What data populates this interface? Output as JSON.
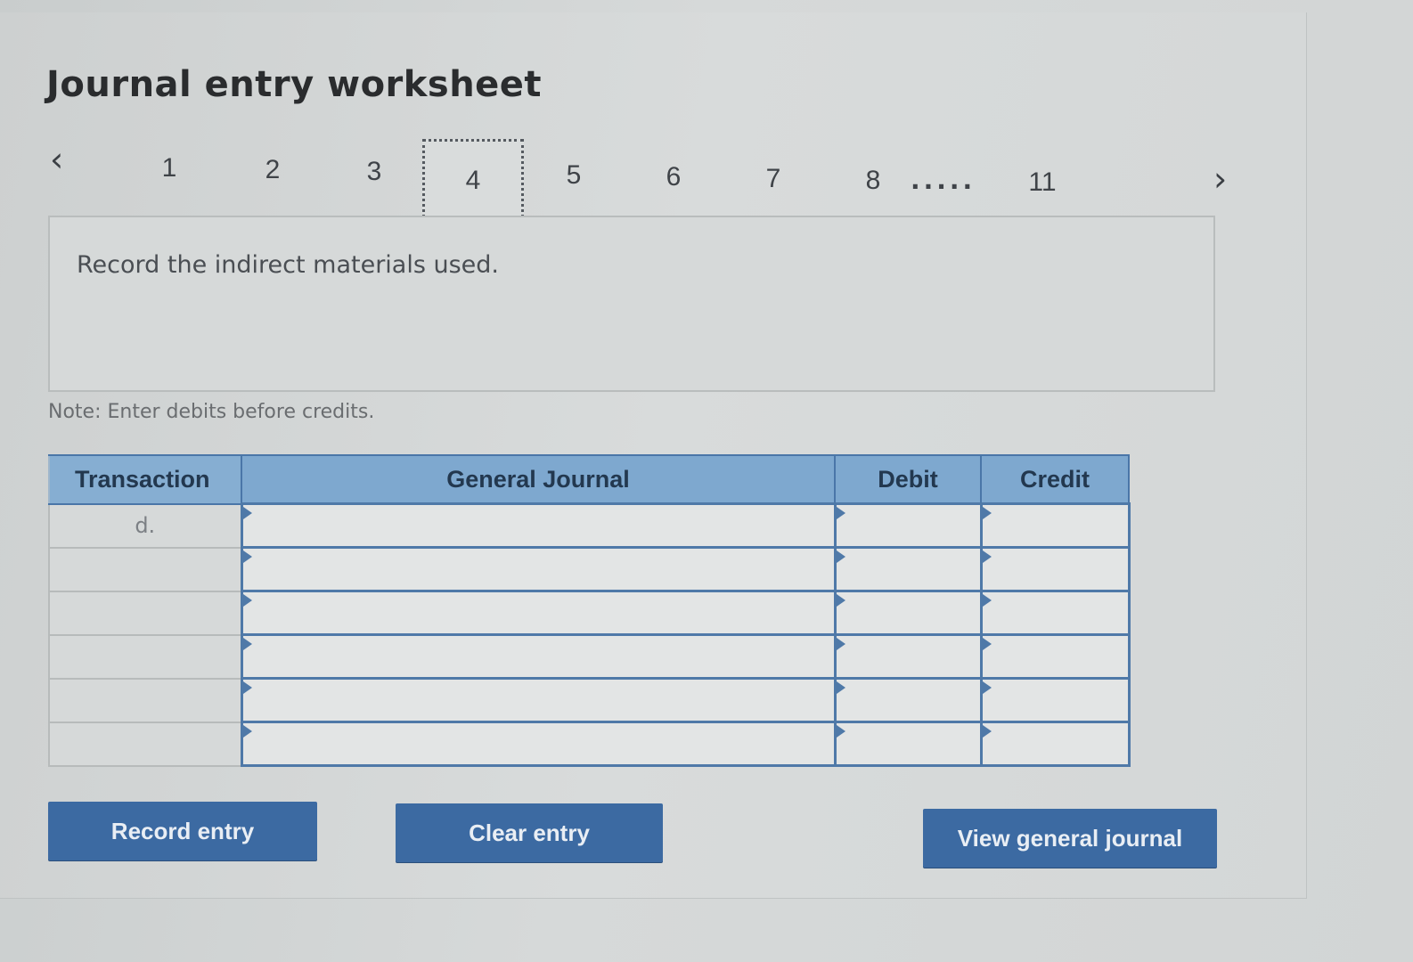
{
  "header": {
    "title": "Journal entry worksheet"
  },
  "navigation": {
    "prev_icon": "chevron-left-icon",
    "next_icon": "chevron-right-icon",
    "tabs": [
      "1",
      "2",
      "3",
      "4",
      "5",
      "6",
      "7",
      "8",
      "11"
    ],
    "active_tab": "4",
    "ellipsis": "....."
  },
  "instruction": {
    "text": "Record the indirect materials used."
  },
  "note": {
    "text": "Note: Enter debits before credits."
  },
  "journal": {
    "columns": {
      "transaction": "Transaction",
      "general_journal": "General Journal",
      "debit": "Debit",
      "credit": "Credit"
    },
    "rows": [
      {
        "transaction": "d.",
        "account": "",
        "debit": "",
        "credit": ""
      },
      {
        "transaction": "",
        "account": "",
        "debit": "",
        "credit": ""
      },
      {
        "transaction": "",
        "account": "",
        "debit": "",
        "credit": ""
      },
      {
        "transaction": "",
        "account": "",
        "debit": "",
        "credit": ""
      },
      {
        "transaction": "",
        "account": "",
        "debit": "",
        "credit": ""
      },
      {
        "transaction": "",
        "account": "",
        "debit": "",
        "credit": ""
      }
    ]
  },
  "buttons": {
    "record_entry": "Record entry",
    "clear_entry": "Clear entry",
    "view_general_journal": "View general journal"
  },
  "colors": {
    "header_blue": "#7ea8cf",
    "button_blue": "#3c6aa2",
    "grid_blue": "#4f79a8"
  }
}
